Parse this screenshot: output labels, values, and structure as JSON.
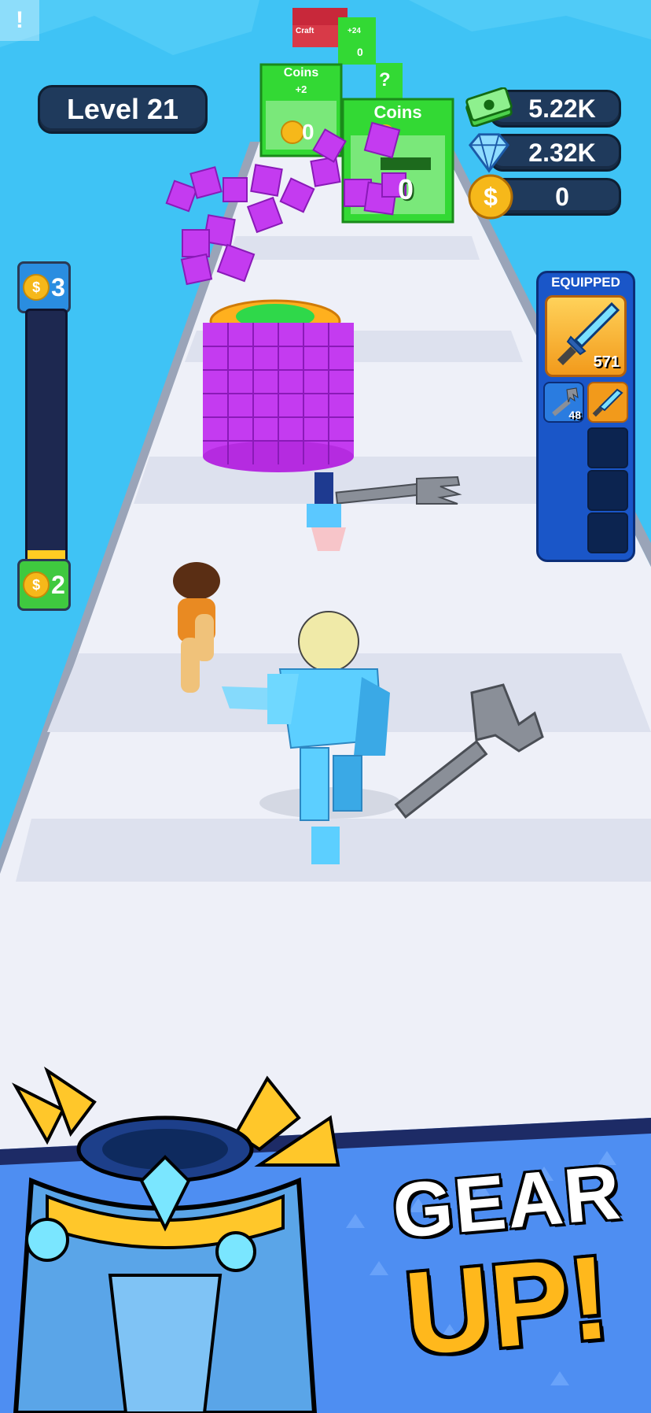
{
  "hud": {
    "debug_glyph": "!",
    "level_label": "Level 21",
    "cash": "5.22K",
    "gems": "2.32K",
    "coins": "0"
  },
  "progress": {
    "next_level_reward": "3",
    "current_level_reward": "2",
    "fraction": 0.05
  },
  "gates": {
    "front_title": "Coins",
    "front_value": "0",
    "back_title": "Coins",
    "back_bonus": "+2",
    "back_value": "0",
    "far_gate_1": "Craft",
    "far_gate_2_bonus": "+24",
    "far_gate_2_value": "0",
    "mystery": "?"
  },
  "equipped": {
    "title": "EQUIPPED",
    "main_weapon_count": "571",
    "slot_2_count": "48"
  },
  "banner": {
    "line1": "GEAR",
    "line2": "UP!"
  },
  "colors": {
    "sky": "#3fc3f5",
    "road": "#eef0f8",
    "gate_green": "#33d934",
    "cube_purple": "#c43bf0",
    "accent_gold": "#ffb81c"
  }
}
